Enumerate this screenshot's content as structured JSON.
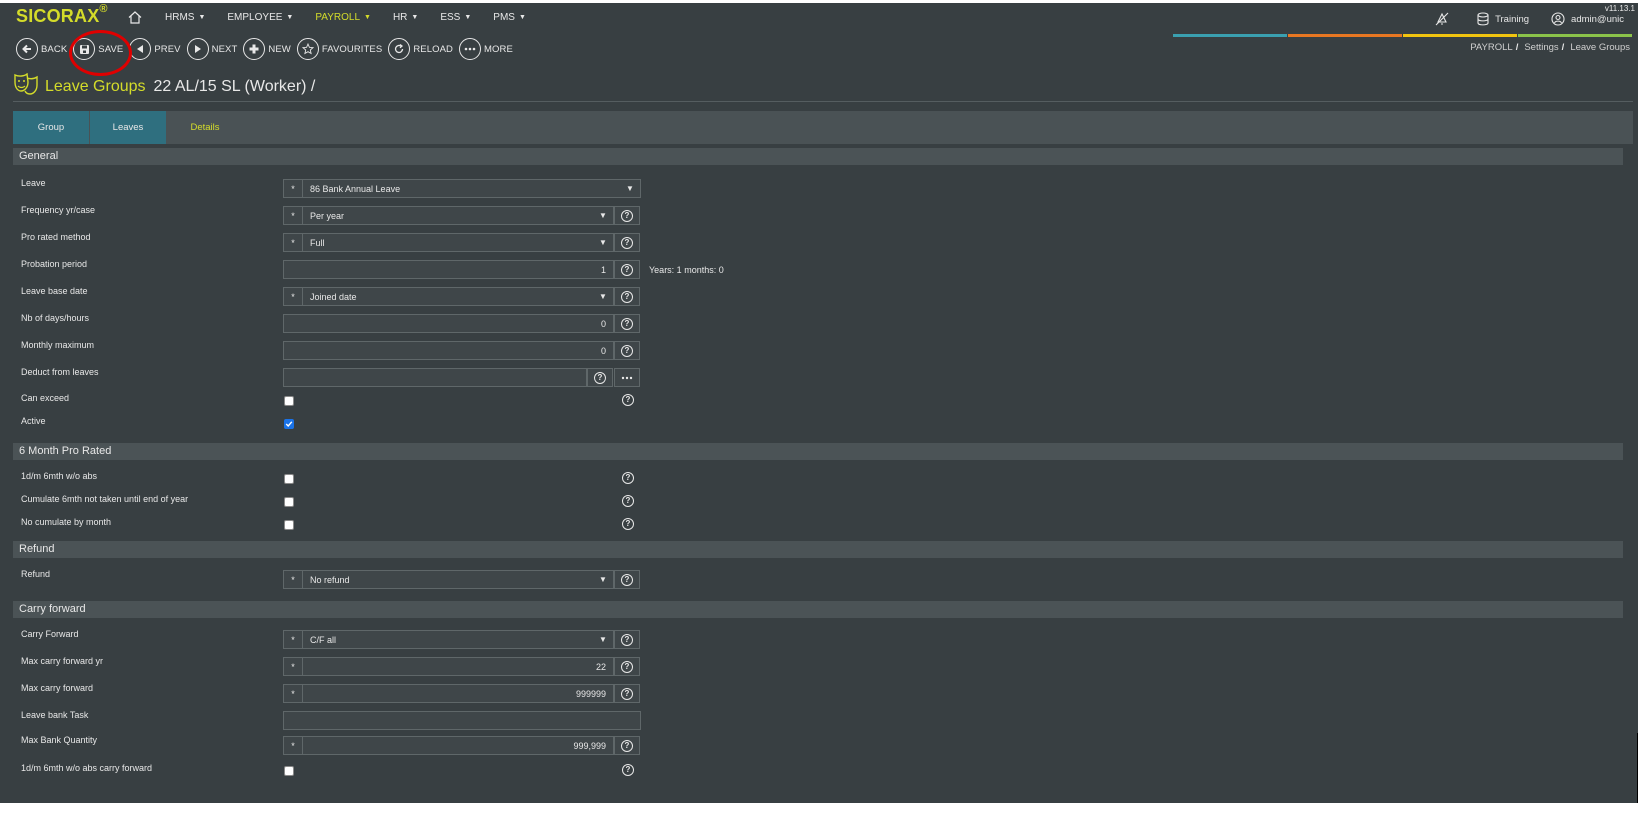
{
  "header": {
    "logo": "SICORAX",
    "logo_mark": "®",
    "version": "v11.13.1",
    "menus": [
      {
        "label": "HRMS",
        "active": false
      },
      {
        "label": "EMPLOYEE",
        "active": false
      },
      {
        "label": "PAYROLL",
        "active": true
      },
      {
        "label": "HR",
        "active": false
      },
      {
        "label": "ESS",
        "active": false
      },
      {
        "label": "PMS",
        "active": false
      }
    ],
    "training_label": "Training",
    "user_label": "admin@unic"
  },
  "toolbar": {
    "back": "BACK",
    "save": "SAVE",
    "prev": "PREV",
    "next": "NEXT",
    "new": "NEW",
    "favourites": "FAVOURITES",
    "reload": "RELOAD",
    "more": "MORE"
  },
  "breadcrumb": [
    "PAYROLL",
    "Settings",
    "Leave Groups"
  ],
  "colorbar": [
    "#3aa0b0",
    "#e87722",
    "#f1c40f",
    "#8bc34a"
  ],
  "title": {
    "module": "Leave Groups",
    "record": "22 AL/15 SL (Worker) /"
  },
  "tabs": [
    {
      "label": "Group",
      "active": false
    },
    {
      "label": "Leaves",
      "active": false
    },
    {
      "label": "Details",
      "active": true
    }
  ],
  "sections": {
    "general": "General",
    "pro_rated": "6 Month Pro Rated",
    "refund": "Refund",
    "carry_forward": "Carry forward"
  },
  "fields": {
    "leave": {
      "label": "Leave",
      "value": "86 Bank Annual Leave",
      "required": "*"
    },
    "frequency": {
      "label": "Frequency yr/case",
      "value": "Per year",
      "required": "*"
    },
    "pro_rated_method": {
      "label": "Pro rated method",
      "value": "Full",
      "required": "*"
    },
    "probation_period": {
      "label": "Probation period",
      "value": "1",
      "note": "Years: 1 months: 0"
    },
    "leave_base_date": {
      "label": "Leave base date",
      "value": "Joined date",
      "required": "*"
    },
    "nb_days_hours": {
      "label": "Nb of days/hours",
      "value": "0"
    },
    "monthly_maximum": {
      "label": "Monthly maximum",
      "value": "0"
    },
    "deduct_from_leaves": {
      "label": "Deduct from leaves",
      "value": ""
    },
    "can_exceed": {
      "label": "Can exceed",
      "checked": false
    },
    "active": {
      "label": "Active",
      "checked": true
    },
    "abs_6mth": {
      "label": "1d/m 6mth w/o abs",
      "checked": false
    },
    "cumulate_6mth": {
      "label": "Cumulate 6mth not taken until end of year",
      "checked": false
    },
    "no_cumulate": {
      "label": "No cumulate by month",
      "checked": false
    },
    "refund": {
      "label": "Refund",
      "value": "No refund",
      "required": "*"
    },
    "carry_forward": {
      "label": "Carry Forward",
      "value": "C/F all",
      "required": "*"
    },
    "max_cf_yr": {
      "label": "Max carry forward yr",
      "value": "22",
      "required": "*"
    },
    "max_cf": {
      "label": "Max carry forward",
      "value": "999999",
      "required": "*"
    },
    "leave_bank_task": {
      "label": "Leave bank Task",
      "value": ""
    },
    "max_bank_qty": {
      "label": "Max Bank Quantity",
      "value": "999,999",
      "required": "*"
    },
    "abs_6mth_cf": {
      "label": "1d/m 6mth w/o abs carry forward",
      "checked": false
    }
  }
}
